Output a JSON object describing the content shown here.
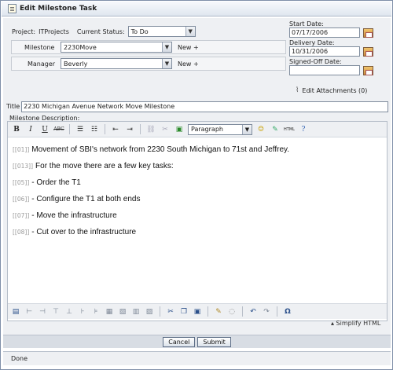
{
  "window": {
    "title": "Edit Milestone Task"
  },
  "form": {
    "project_label": "Project:",
    "project_value": "ITProjects",
    "status_label": "Current Status:",
    "status_value": "To Do",
    "milestone_label": "Milestone",
    "milestone_value": "2230Move",
    "manager_label": "Manager",
    "manager_value": "Beverly",
    "new_plus": "New +",
    "start_label": "Start Date:",
    "start_value": "07/17/2006",
    "delivery_label": "Delivery Date:",
    "delivery_value": "10/31/2006",
    "signoff_label": "Signed-Off Date:",
    "signoff_value": "",
    "attachments_label": "Edit Attachments (0)",
    "title_label": "Title",
    "title_value": "2230 Michigan Avenue Network Move Milestone",
    "desc_label": "Milestone Description:"
  },
  "editor": {
    "toolbar": {
      "bold": "B",
      "italic": "I",
      "underline": "U",
      "strike": "ABC",
      "paragraph": "Paragraph",
      "html": "HTML"
    },
    "lines": [
      {
        "tag": "[[01]]",
        "text": "Movement of SBI's network from 2230 South Michigan to 71st and Jeffrey."
      },
      {
        "tag": "[[013]]",
        "text": "For the move there are a few key tasks:"
      },
      {
        "tag": "[[05]]",
        "text": "- Order the T1"
      },
      {
        "tag": "[[06]]",
        "text": "- Configure the T1 at both ends"
      },
      {
        "tag": "[[07]]",
        "text": "- Move the infrastructure"
      },
      {
        "tag": "[[08]]",
        "text": "- Cut over to the infrastructure"
      }
    ],
    "simplify": "▴ Simplify HTML",
    "omega": "Ω"
  },
  "buttons": {
    "cancel": "Cancel",
    "submit": "Submit"
  },
  "status": {
    "text": "Done"
  }
}
